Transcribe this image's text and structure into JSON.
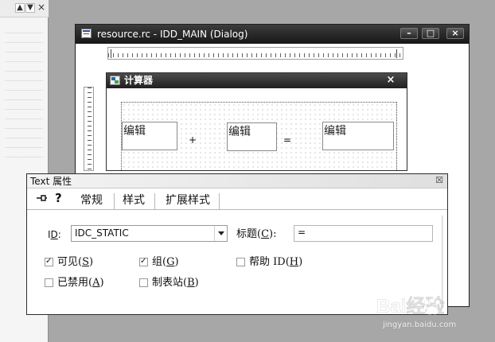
{
  "left_pane": {
    "buttons": {
      "scroll_up": "▲",
      "scroll_down": "▼",
      "close": "×"
    }
  },
  "main_window": {
    "title": "resource.rc - IDD_MAIN (Dialog)",
    "buttons": {
      "minimize": "–",
      "maximize": "□",
      "close": "×"
    }
  },
  "calculator_dialog": {
    "title": "计算器",
    "close": "×",
    "controls": {
      "edit_1": "编辑",
      "plus": "+",
      "edit_2": "编辑",
      "equals": "=",
      "edit_3": "编辑"
    }
  },
  "properties": {
    "title": "Text 属性",
    "close": "☒",
    "help_icon": "?",
    "tabs": [
      {
        "label": "常规"
      },
      {
        "label": "样式"
      },
      {
        "label": "扩展样式"
      }
    ],
    "id": {
      "prefix": "I",
      "underlined": "D",
      "suffix": ":",
      "value": "IDC_STATIC"
    },
    "caption": {
      "prefix": "标题(",
      "underlined": "C",
      "suffix": "):",
      "value": "="
    },
    "checkboxes": {
      "visible": {
        "prefix": "可见(",
        "underlined": "S",
        "suffix": ")",
        "checked": true
      },
      "group": {
        "prefix": "组(",
        "underlined": "G",
        "suffix": ")",
        "checked": true
      },
      "help_id": {
        "prefix": "帮助 ID(",
        "underlined": "H",
        "suffix": ")",
        "checked": false
      },
      "disabled": {
        "prefix": "已禁用(",
        "underlined": "A",
        "suffix": ")",
        "checked": false
      },
      "tab_stop": {
        "prefix": "制表站(",
        "underlined": "B",
        "suffix": ")",
        "checked": false
      }
    }
  },
  "watermark": {
    "logo_text": "Bai经验",
    "url": "jingyan.baidu.com"
  },
  "colors": {
    "background": "#a7a7a7",
    "titlebar_dark": "#171717",
    "dialog_white": "#ffffff",
    "border_dark": "#2c2c2c"
  }
}
